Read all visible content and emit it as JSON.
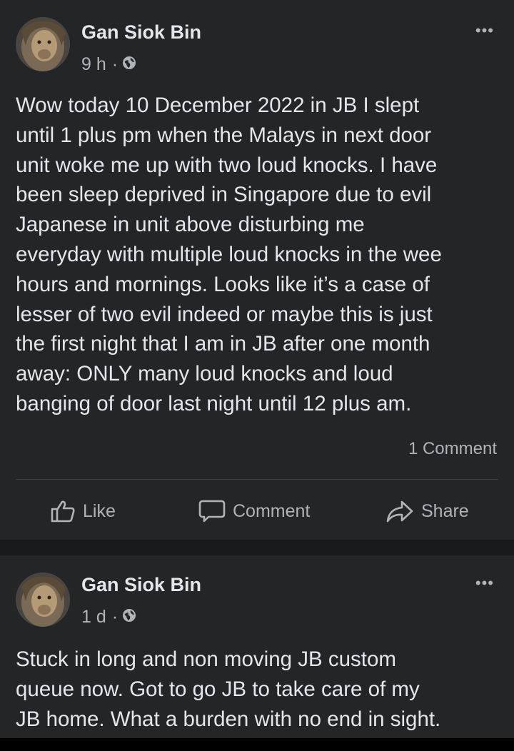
{
  "posts": [
    {
      "author": "Gan Siok Bin",
      "time": "9 h",
      "separator": "·",
      "body": "Wow today 10 December 2022 in JB I slept\nuntil 1 plus pm when the Malays in next door\nunit woke me up with two loud knocks. I have\nbeen sleep deprived in Singapore due to evil\nJapanese in unit above disturbing me\neveryday with multiple loud knocks in the wee\nhours and mornings. Looks like it’s a case of\nlesser of two evil indeed or maybe this is just\nthe first night that I am in JB after one month\naway: ONLY many loud knocks and loud\nbanging of door last night until 12 plus am.",
      "comment_count": "1 Comment",
      "actions": {
        "like": "Like",
        "comment": "Comment",
        "share": "Share"
      }
    },
    {
      "author": "Gan Siok Bin",
      "time": "1 d",
      "separator": "·",
      "body": "Stuck in long and non moving JB custom\nqueue now. Got to go JB to take care of my\nJB home. What a burden with no end in sight."
    }
  ],
  "more_icon": "•••",
  "icons": {
    "privacy": "globe-icon",
    "more": "more-options-icon",
    "like": "thumbs-up-icon",
    "comment": "speech-bubble-icon",
    "share": "share-arrow-icon"
  },
  "colors": {
    "background": "#18191a",
    "card": "#242526",
    "text": "#e4e6eb",
    "secondary": "#b0b3b8"
  }
}
